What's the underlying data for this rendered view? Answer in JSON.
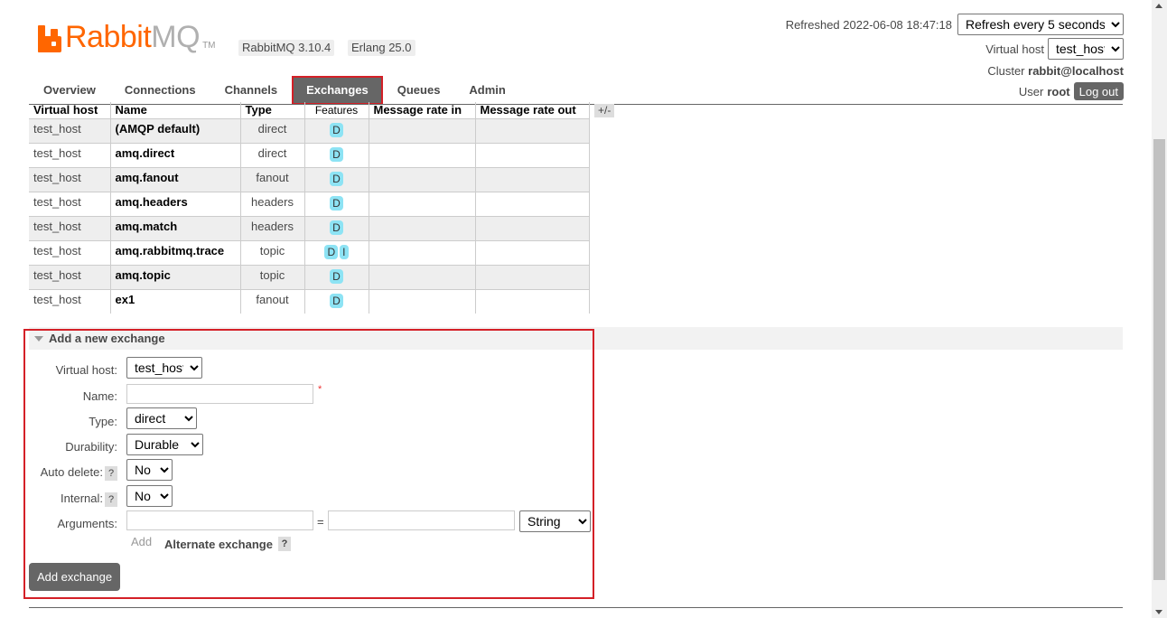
{
  "app": {
    "logo_rabbit": "Rabbit",
    "logo_mq": "MQ",
    "logo_tm": "TM",
    "version_rabbitmq": "RabbitMQ 3.10.4",
    "version_erlang": "Erlang 25.0",
    "brand_color": "#ff6600"
  },
  "header": {
    "refreshed_text": "Refreshed 2022-06-08 18:47:18",
    "refresh_option": "Refresh every 5 seconds",
    "virtual_host_label": "Virtual host",
    "virtual_host_value": "test_host",
    "cluster_label": "Cluster",
    "cluster_value": "rabbit@localhost",
    "user_label": "User",
    "user_value": "root",
    "logout_label": "Log out"
  },
  "tabs": [
    {
      "label": "Overview"
    },
    {
      "label": "Connections"
    },
    {
      "label": "Channels"
    },
    {
      "label": "Exchanges",
      "active": true
    },
    {
      "label": "Queues"
    },
    {
      "label": "Admin"
    }
  ],
  "table": {
    "headers": [
      "Virtual host",
      "Name",
      "Type",
      "Features",
      "Message rate in",
      "Message rate out"
    ],
    "toggle_columns": "+/-",
    "rows": [
      {
        "vhost": "test_host",
        "name": "(AMQP default)",
        "type": "direct",
        "features": [
          "D"
        ]
      },
      {
        "vhost": "test_host",
        "name": "amq.direct",
        "type": "direct",
        "features": [
          "D"
        ]
      },
      {
        "vhost": "test_host",
        "name": "amq.fanout",
        "type": "fanout",
        "features": [
          "D"
        ]
      },
      {
        "vhost": "test_host",
        "name": "amq.headers",
        "type": "headers",
        "features": [
          "D"
        ]
      },
      {
        "vhost": "test_host",
        "name": "amq.match",
        "type": "headers",
        "features": [
          "D"
        ]
      },
      {
        "vhost": "test_host",
        "name": "amq.rabbitmq.trace",
        "type": "topic",
        "features": [
          "D",
          "I"
        ]
      },
      {
        "vhost": "test_host",
        "name": "amq.topic",
        "type": "topic",
        "features": [
          "D"
        ]
      },
      {
        "vhost": "test_host",
        "name": "ex1",
        "type": "fanout",
        "features": [
          "D"
        ]
      }
    ]
  },
  "add_exchange": {
    "title": "Add a new exchange",
    "virtual_host_label": "Virtual host:",
    "virtual_host_value": "test_host",
    "name_label": "Name:",
    "name_value": "",
    "required_mark": "*",
    "type_label": "Type:",
    "type_value": "direct",
    "durability_label": "Durability:",
    "durability_value": "Durable",
    "auto_delete_label": "Auto delete:",
    "auto_delete_value": "No",
    "internal_label": "Internal:",
    "internal_value": "No",
    "help_mark": "?",
    "arguments_label": "Arguments:",
    "arguments_eq": "=",
    "arguments_type_value": "String",
    "add_link": "Add",
    "alternate_exchange": "Alternate exchange",
    "submit_label": "Add exchange"
  }
}
